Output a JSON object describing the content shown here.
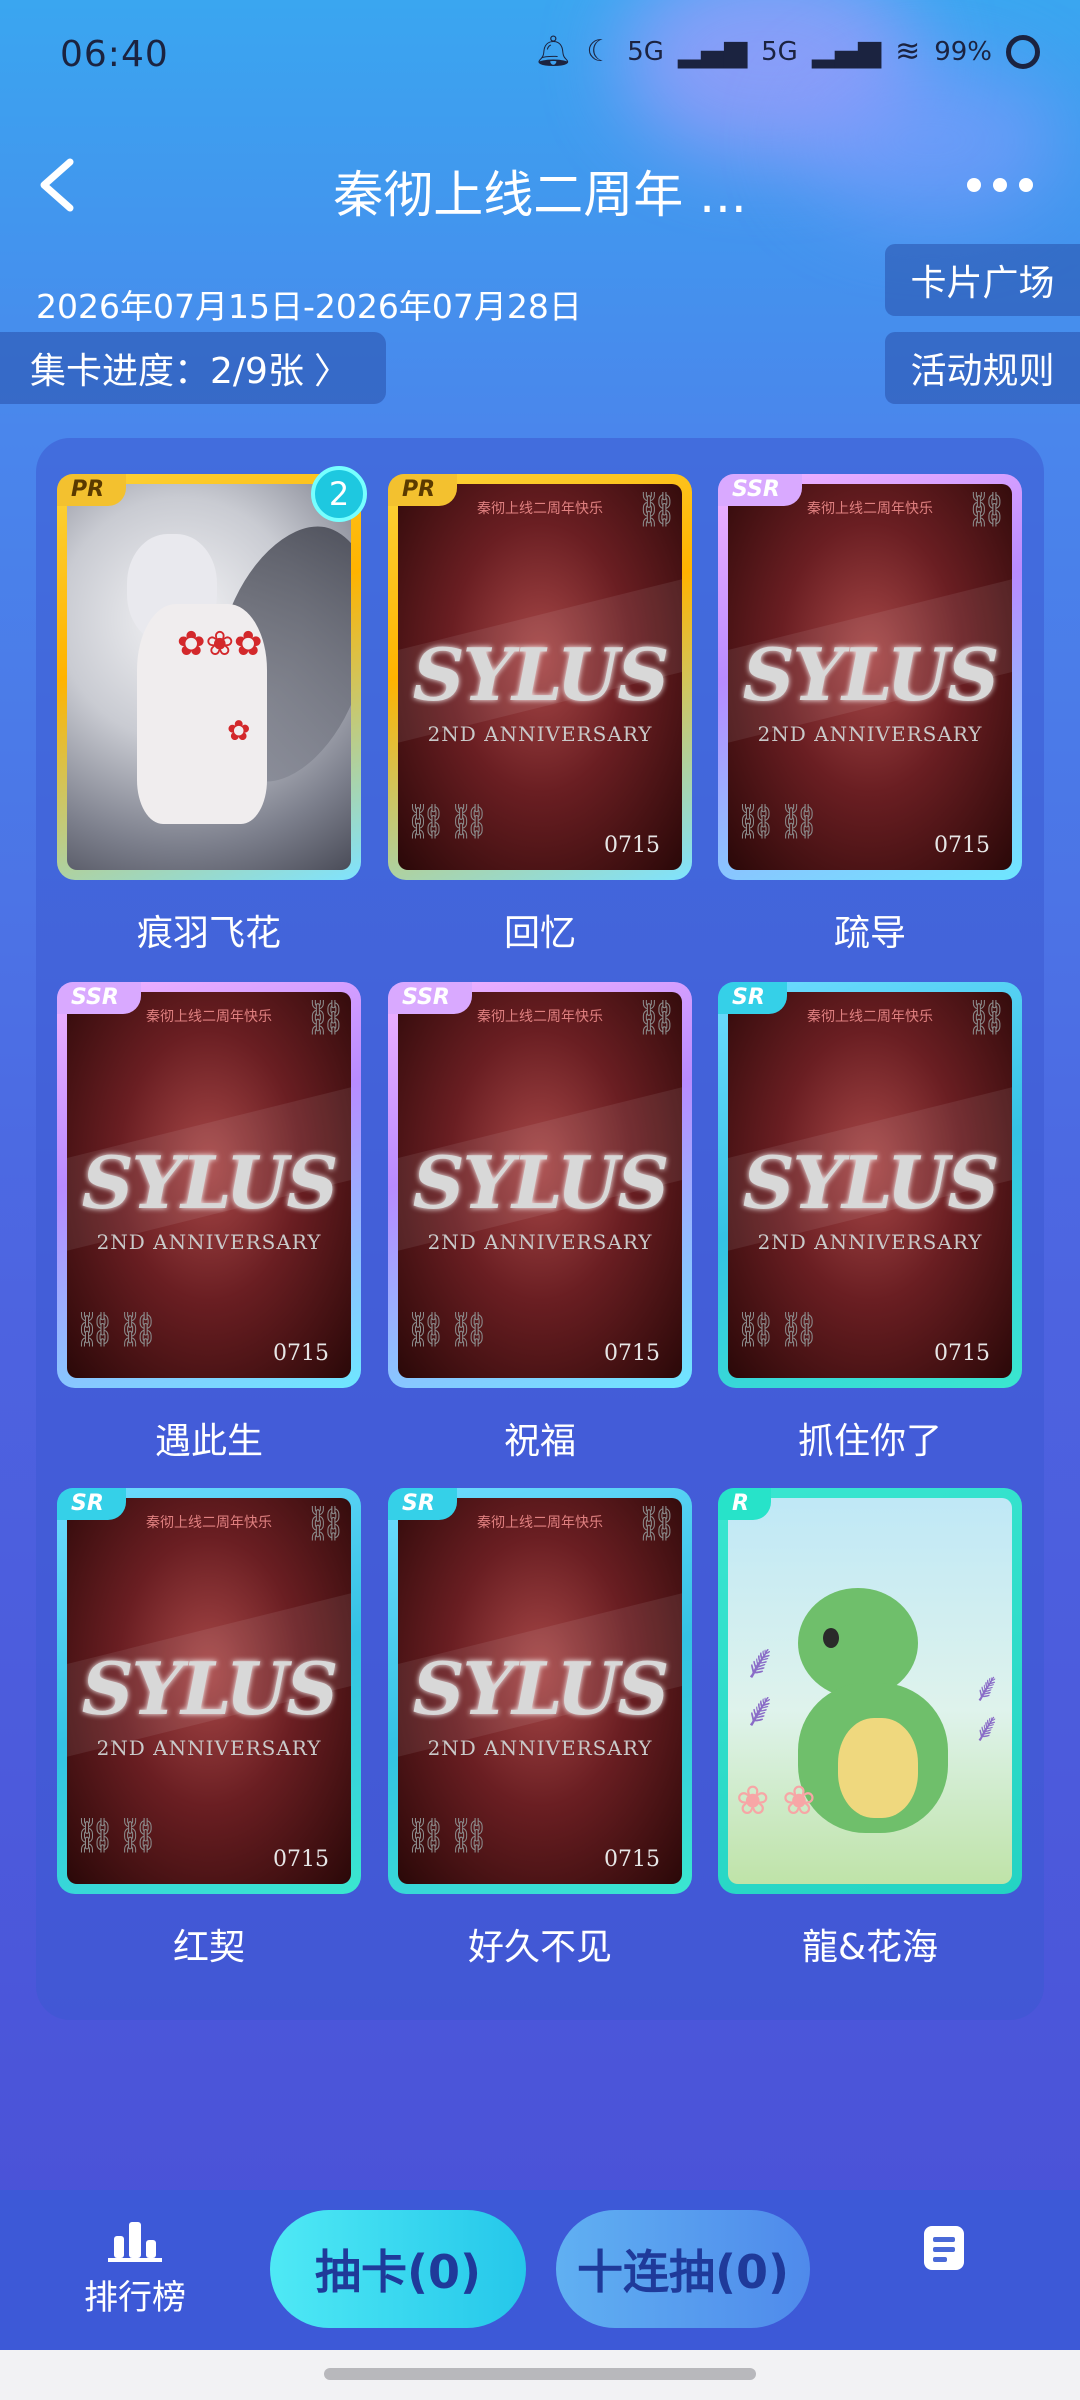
{
  "status": {
    "time": "06:40",
    "sig1": "5G",
    "sig2": "5G",
    "battery": "99%"
  },
  "header": {
    "title": "秦彻上线二周年 ...",
    "date_range": "2026年07月15日-2026年07月28日",
    "card_plaza": "卡片广场",
    "progress": "集卡进度：2/9张",
    "rules": "活动规则"
  },
  "cards": [
    {
      "rarity": "PR",
      "name": "痕羽飞花",
      "count": "2"
    },
    {
      "rarity": "PR",
      "name": "回忆"
    },
    {
      "rarity": "SSR",
      "name": "疏导"
    },
    {
      "rarity": "SSR",
      "name": "遇此生"
    },
    {
      "rarity": "SSR",
      "name": "祝福"
    },
    {
      "rarity": "SR",
      "name": "抓住你了"
    },
    {
      "rarity": "SR",
      "name": "红契"
    },
    {
      "rarity": "SR",
      "name": "好久不见"
    },
    {
      "rarity": "R",
      "name": "龍&花海"
    }
  ],
  "card_art": {
    "title": "SYLUS",
    "subtitle": "2ND ANNIVERSARY",
    "number": "0715",
    "caption": "秦彻上线二周年快乐"
  },
  "bottom": {
    "rank_label": "排行榜",
    "draw_one": "抽卡(0)",
    "draw_ten": "十连抽(0)"
  },
  "colors": {
    "PR": "#f3c12f",
    "SSR": "#d9a9ff",
    "SR": "#35d0e8",
    "R": "#27e3c9"
  }
}
